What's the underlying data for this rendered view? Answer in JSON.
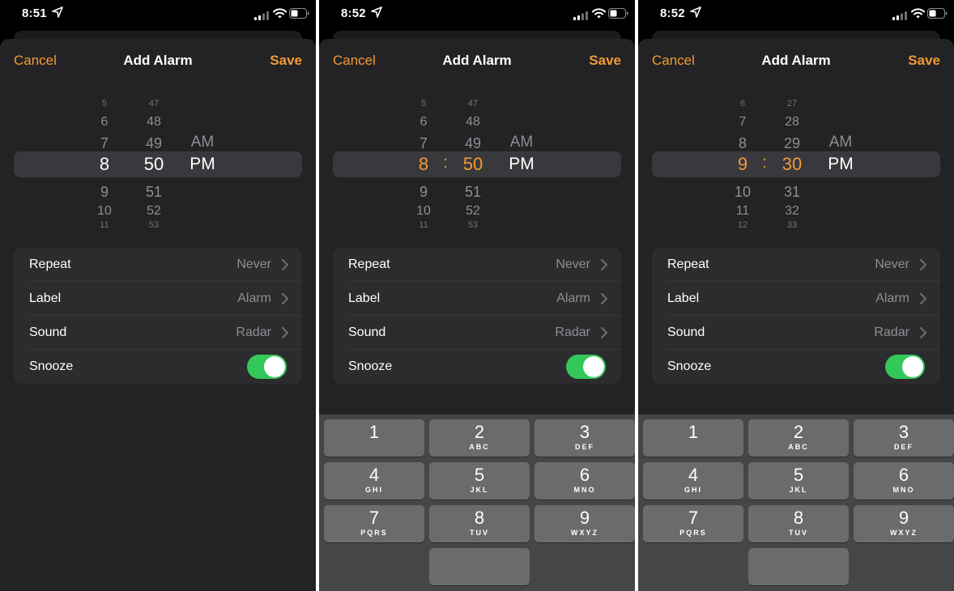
{
  "screens": [
    {
      "status": {
        "time": "8:51"
      },
      "nav": {
        "cancel": "Cancel",
        "title": "Add Alarm",
        "save": "Save"
      },
      "picker": {
        "hours": [
          "5",
          "6",
          "7",
          "8",
          "9",
          "10",
          "11"
        ],
        "minutes": [
          "47",
          "48",
          "49",
          "50",
          "51",
          "52",
          "53"
        ],
        "ampm": [
          "AM",
          "PM"
        ],
        "selected_hour": "8",
        "selected_minute": "50",
        "selected_period": "PM",
        "editing": false
      },
      "settings": [
        {
          "label": "Repeat",
          "value": "Never"
        },
        {
          "label": "Label",
          "value": "Alarm"
        },
        {
          "label": "Sound",
          "value": "Radar"
        },
        {
          "label": "Snooze",
          "toggle": true
        }
      ],
      "keyboard": null
    },
    {
      "status": {
        "time": "8:52"
      },
      "nav": {
        "cancel": "Cancel",
        "title": "Add Alarm",
        "save": "Save"
      },
      "picker": {
        "hours": [
          "5",
          "6",
          "7",
          "8",
          "9",
          "10",
          "11"
        ],
        "minutes": [
          "47",
          "48",
          "49",
          "50",
          "51",
          "52",
          "53"
        ],
        "ampm": [
          "AM",
          "PM"
        ],
        "selected_hour": "8",
        "selected_minute": "50",
        "selected_period": "PM",
        "separator": ":",
        "editing": true
      },
      "settings": [
        {
          "label": "Repeat",
          "value": "Never"
        },
        {
          "label": "Label",
          "value": "Alarm"
        },
        {
          "label": "Sound",
          "value": "Radar"
        },
        {
          "label": "Snooze",
          "toggle": true
        }
      ],
      "keyboard": [
        {
          "num": "1",
          "letters": ""
        },
        {
          "num": "2",
          "letters": "ABC"
        },
        {
          "num": "3",
          "letters": "DEF"
        },
        {
          "num": "4",
          "letters": "GHI"
        },
        {
          "num": "5",
          "letters": "JKL"
        },
        {
          "num": "6",
          "letters": "MNO"
        },
        {
          "num": "7",
          "letters": "PQRS"
        },
        {
          "num": "8",
          "letters": "TUV"
        },
        {
          "num": "9",
          "letters": "WXYZ"
        }
      ]
    },
    {
      "status": {
        "time": "8:52"
      },
      "nav": {
        "cancel": "Cancel",
        "title": "Add Alarm",
        "save": "Save"
      },
      "picker": {
        "hours": [
          "6",
          "7",
          "8",
          "9",
          "10",
          "11",
          "12"
        ],
        "minutes": [
          "27",
          "28",
          "29",
          "30",
          "31",
          "32",
          "33"
        ],
        "ampm": [
          "AM",
          "PM"
        ],
        "selected_hour": "9",
        "selected_minute": "30",
        "selected_period": "PM",
        "separator": ":",
        "editing": true
      },
      "settings": [
        {
          "label": "Repeat",
          "value": "Never"
        },
        {
          "label": "Label",
          "value": "Alarm"
        },
        {
          "label": "Sound",
          "value": "Radar"
        },
        {
          "label": "Snooze",
          "toggle": true
        }
      ],
      "keyboard": [
        {
          "num": "1",
          "letters": ""
        },
        {
          "num": "2",
          "letters": "ABC"
        },
        {
          "num": "3",
          "letters": "DEF"
        },
        {
          "num": "4",
          "letters": "GHI"
        },
        {
          "num": "5",
          "letters": "JKL"
        },
        {
          "num": "6",
          "letters": "MNO"
        },
        {
          "num": "7",
          "letters": "PQRS"
        },
        {
          "num": "8",
          "letters": "TUV"
        },
        {
          "num": "9",
          "letters": "WXYZ"
        }
      ]
    }
  ],
  "colors": {
    "accent": "#f29a34",
    "toggle_on": "#34c759",
    "sheet_bg": "#232325",
    "group_bg": "#2c2c2e"
  },
  "icons": [
    "location-arrow-icon",
    "cellular-signal-icon",
    "wifi-icon",
    "battery-icon",
    "chevron-right-icon"
  ]
}
